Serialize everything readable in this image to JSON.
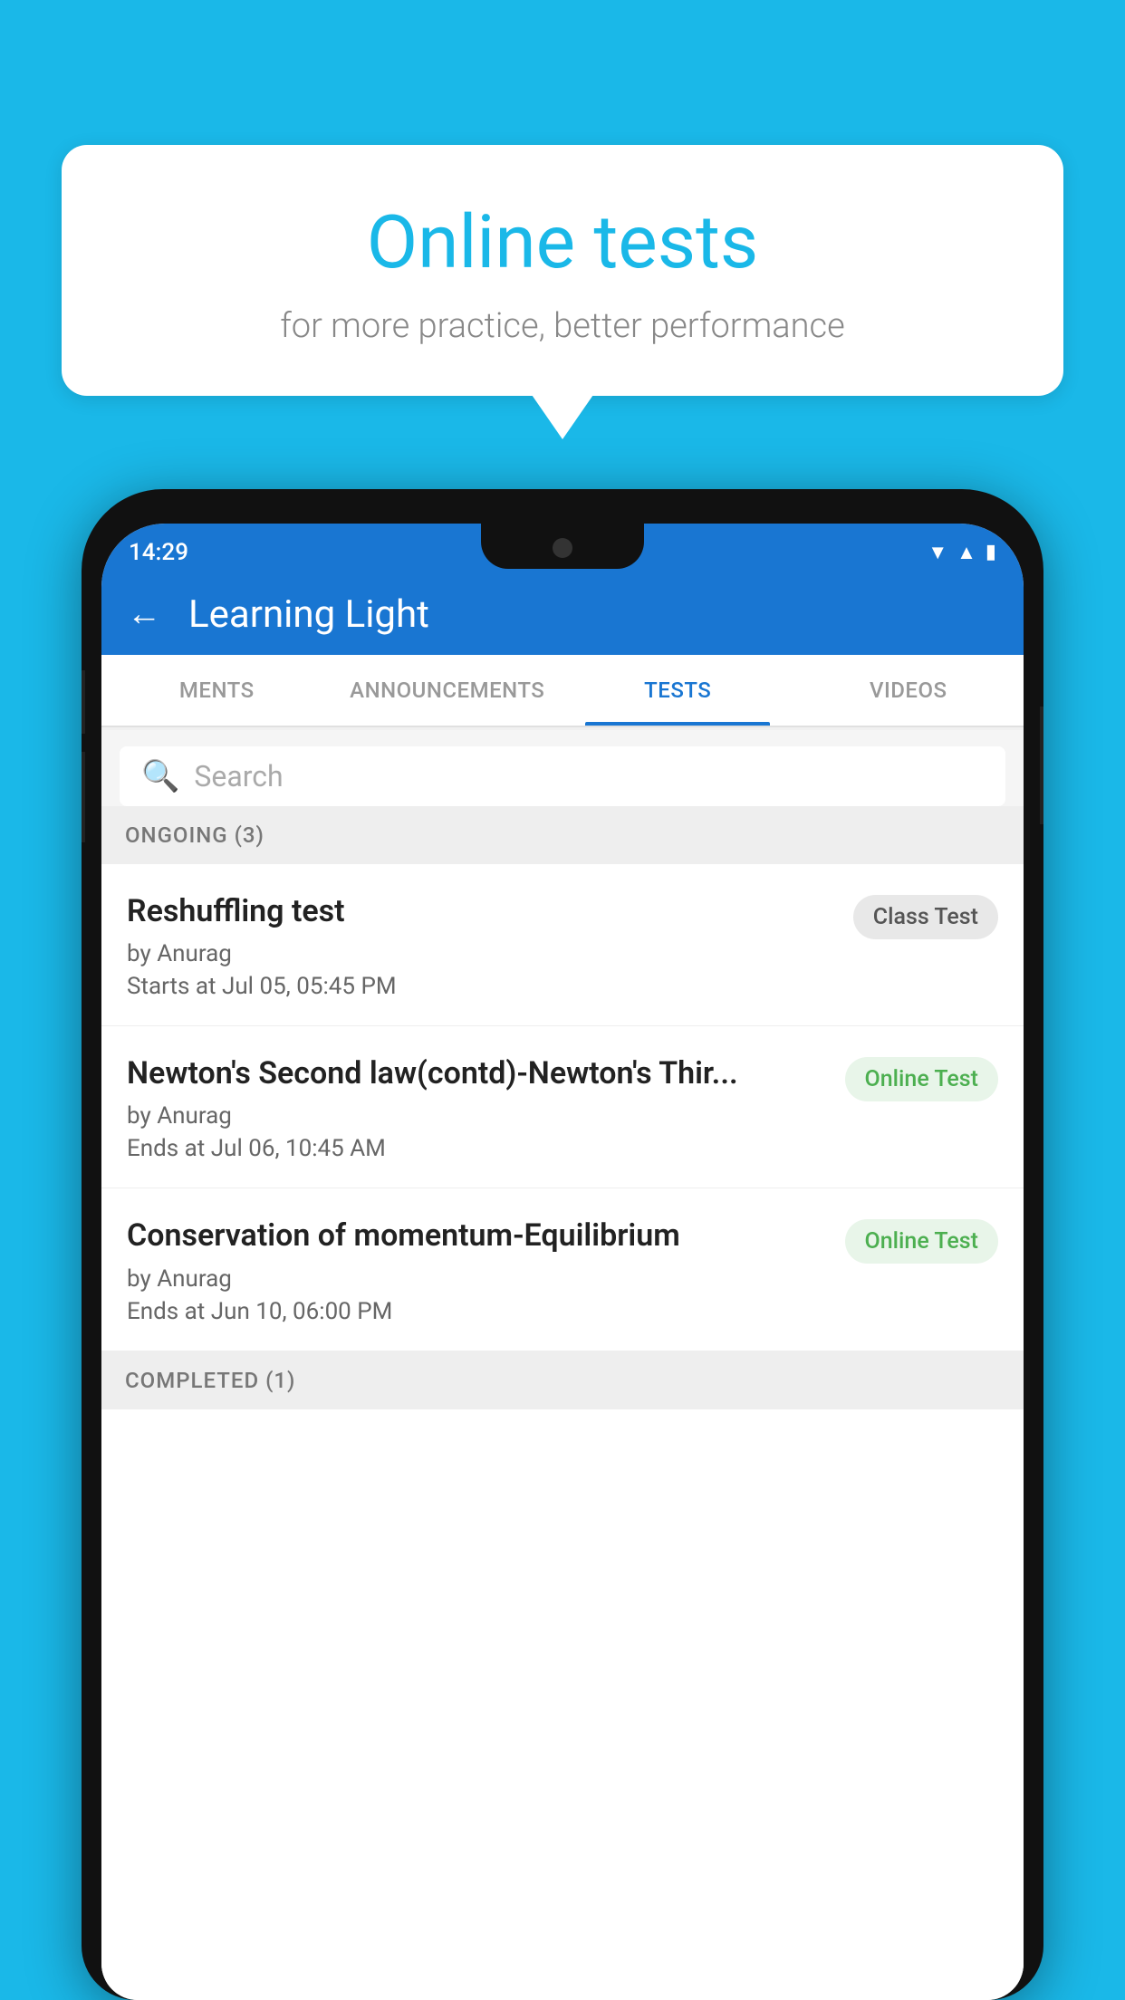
{
  "background_color": "#1ab8e8",
  "bubble": {
    "title": "Online tests",
    "subtitle": "for more practice, better performance"
  },
  "phone": {
    "status_bar": {
      "time": "14:29",
      "icons": [
        "wifi",
        "signal",
        "battery"
      ]
    },
    "app_header": {
      "title": "Learning Light",
      "back_label": "←"
    },
    "tabs": [
      {
        "label": "MENTS",
        "active": false
      },
      {
        "label": "ANNOUNCEMENTS",
        "active": false
      },
      {
        "label": "TESTS",
        "active": true
      },
      {
        "label": "VIDEOS",
        "active": false
      }
    ],
    "search": {
      "placeholder": "Search"
    },
    "ongoing_section": {
      "label": "ONGOING (3)",
      "tests": [
        {
          "name": "Reshuffling test",
          "author": "by Anurag",
          "date": "Starts at  Jul 05, 05:45 PM",
          "badge": "Class Test",
          "badge_type": "class"
        },
        {
          "name": "Newton's Second law(contd)-Newton's Thir...",
          "author": "by Anurag",
          "date": "Ends at  Jul 06, 10:45 AM",
          "badge": "Online Test",
          "badge_type": "online"
        },
        {
          "name": "Conservation of momentum-Equilibrium",
          "author": "by Anurag",
          "date": "Ends at  Jun 10, 06:00 PM",
          "badge": "Online Test",
          "badge_type": "online"
        }
      ]
    },
    "completed_section": {
      "label": "COMPLETED (1)"
    }
  }
}
